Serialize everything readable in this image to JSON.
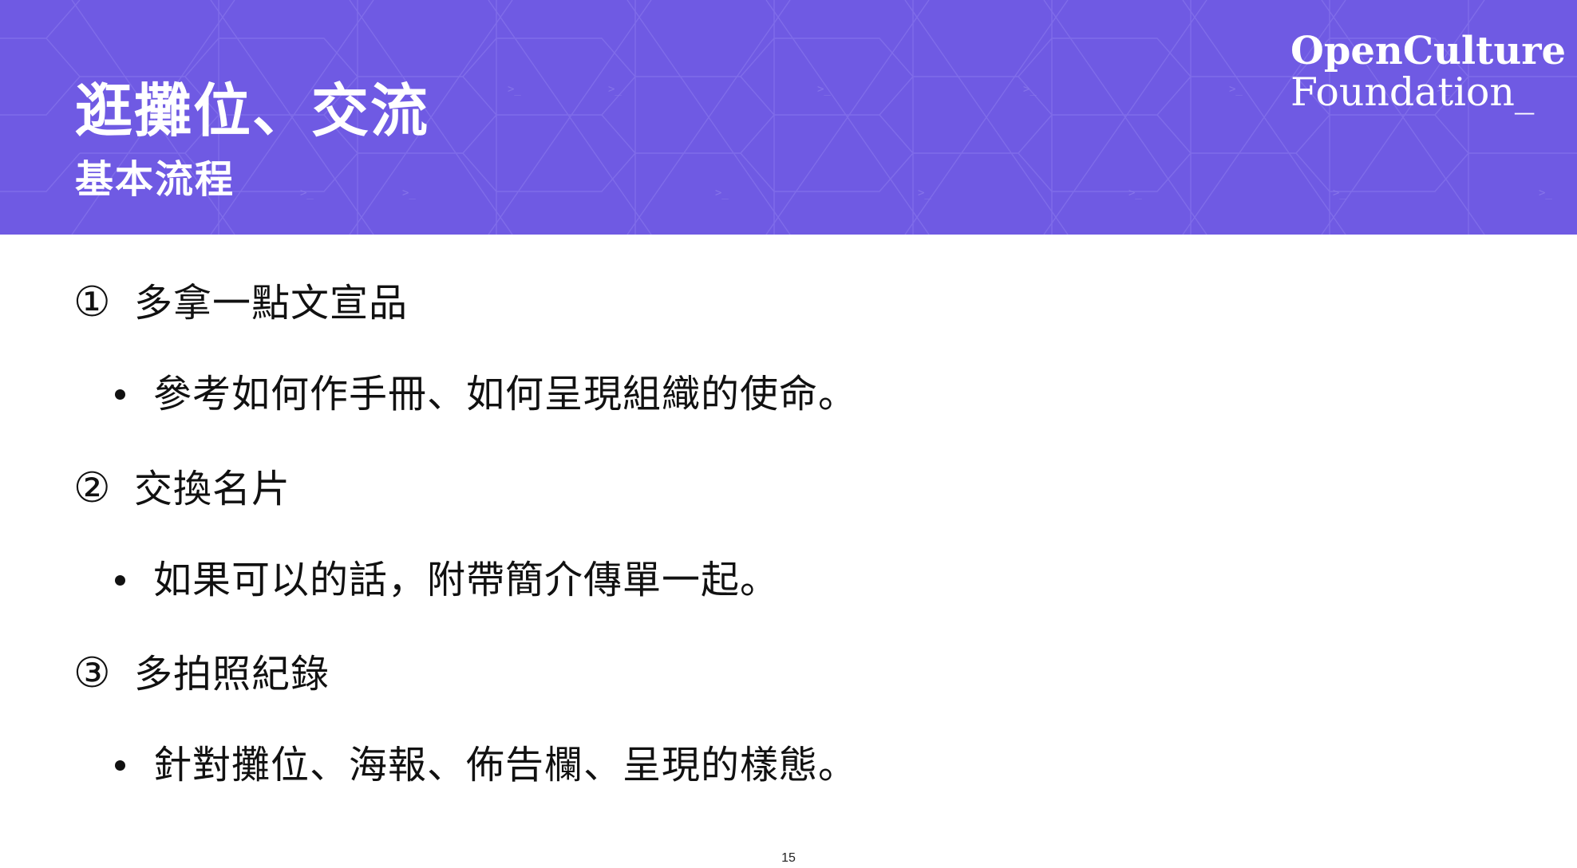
{
  "slide": {
    "title": "逛攤位、交流",
    "subtitle": "基本流程",
    "logo": {
      "line1": "OpenCulture",
      "line2": "Foundation_"
    },
    "items": [
      {
        "number": "①",
        "heading": "多拿一點文宣品",
        "detail": "參考如何作手冊、如何呈現組織的使命。"
      },
      {
        "number": "②",
        "heading": "交換名片",
        "detail": "如果可以的話，附帶簡介傳單一起。"
      },
      {
        "number": "③",
        "heading": "多拍照紀錄",
        "detail": "針對攤位、海報、佈告欄、呈現的樣態。"
      }
    ],
    "page_number": "15"
  },
  "colors": {
    "header_background": "#6f5ae3",
    "header_text": "#ffffff",
    "body_text": "#111111",
    "slide_background": "#ffffff"
  }
}
